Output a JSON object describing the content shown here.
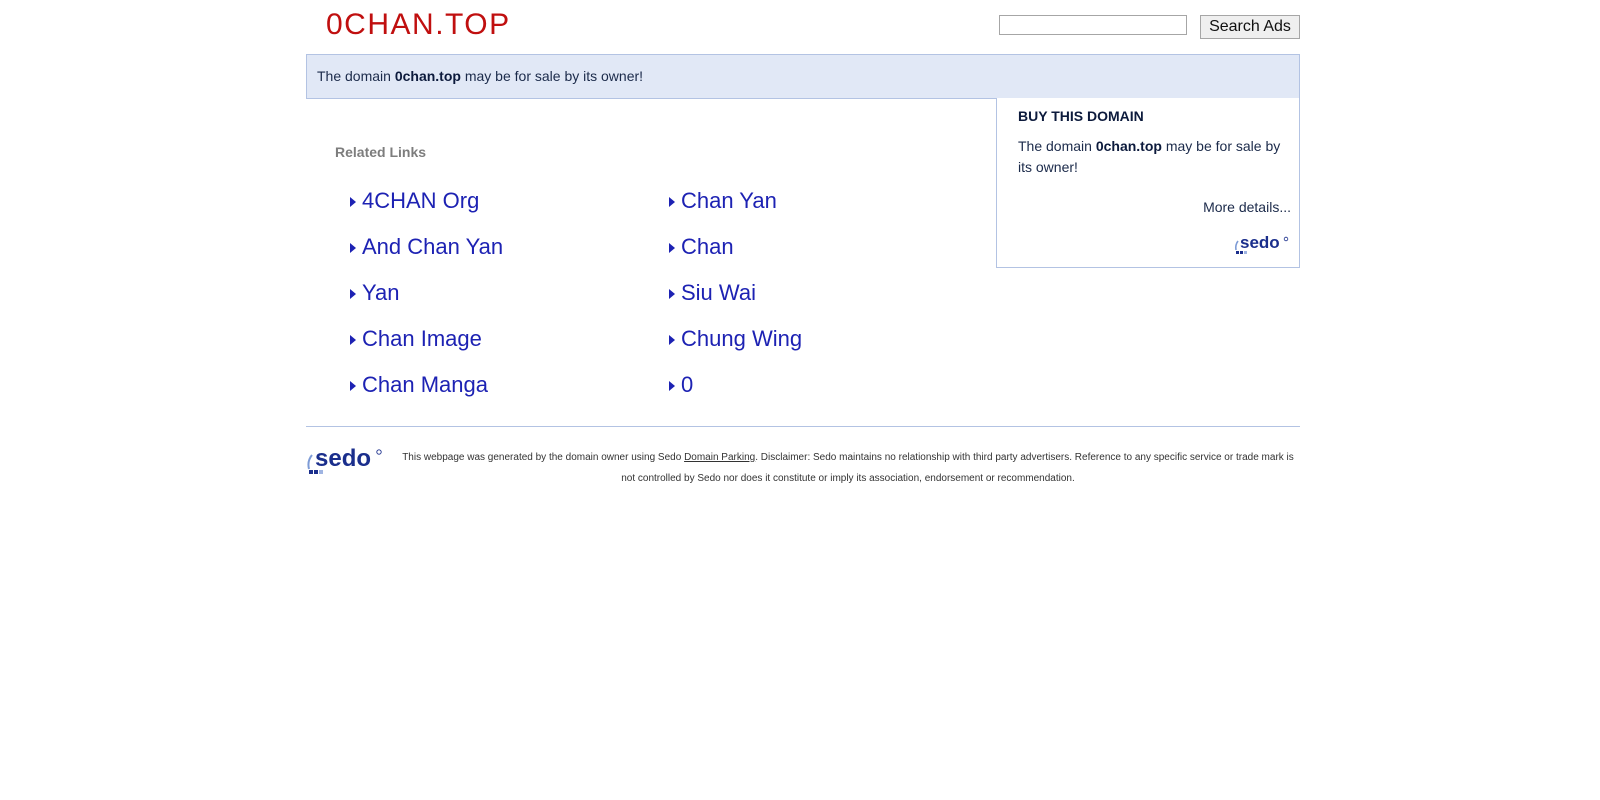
{
  "header": {
    "site_title": "0CHAN.TOP",
    "search_value": "",
    "search_button_label": "Search Ads"
  },
  "banner": {
    "prefix": "The domain ",
    "domain": "0chan.top",
    "suffix": " may be for sale by its owner!"
  },
  "related": {
    "heading": "Related Links",
    "left": [
      "4CHAN Org",
      "And Chan Yan",
      "Yan",
      "Chan Image",
      "Chan Manga"
    ],
    "right": [
      "Chan Yan",
      "Chan",
      "Siu Wai",
      "Chung Wing",
      "0"
    ]
  },
  "buy_box": {
    "title": "BUY THIS DOMAIN",
    "text_prefix": "The domain ",
    "domain": "0chan.top",
    "text_suffix": " may be for sale by its owner!",
    "more_details": "More details...",
    "logo_text": "sedo"
  },
  "footer": {
    "logo_text": "sedo",
    "text_before_link": "This webpage was generated by the domain owner using Sedo ",
    "link_text": "Domain Parking",
    "text_after_link": ". Disclaimer: Sedo maintains no relationship with third party advertisers. Reference to any specific service or trade mark is not controlled by Sedo nor does it constitute or imply its association, endorsement or recommendation."
  },
  "colors": {
    "title_red": "#c00f0f",
    "link_blue": "#1d22b3",
    "banner_bg": "#e1e8f6",
    "border_blue": "#b3c3e3",
    "sedo_blue": "#1a2e8c"
  }
}
